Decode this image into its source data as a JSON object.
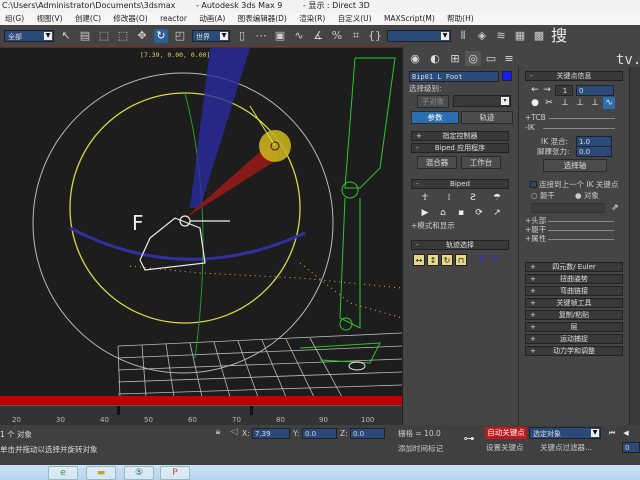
{
  "title": {
    "path": "C:\\Users\\Administrator\\Documents\\3dsmax",
    "app": "- Autodesk 3ds Max 9",
    "display": "- 显示 : Direct 3D"
  },
  "menu": [
    "组(G)",
    "视图(V)",
    "创建(C)",
    "修改器(O)",
    "reactor",
    "动画(A)",
    "图表编辑器(D)",
    "渲染(R)",
    "自定义(U)",
    "MAXScript(M)",
    "帮助(H)"
  ],
  "toolbar": {
    "selection_filter": "全部",
    "ref_coord": "世界",
    "named_sel": "",
    "watermark": "搜"
  },
  "viewport": {
    "coord_readout": "[7.39, 0.00, 0.00]",
    "axis_label": "F",
    "watermark": "tv."
  },
  "timeline": {
    "ticks": [
      "20",
      "30",
      "40",
      "50",
      "60",
      "70",
      "80",
      "90",
      "100"
    ]
  },
  "status": {
    "selected": "1 个 对象",
    "prompt": "单击并拖动以选择并旋转对象",
    "x_label": "X:",
    "x": "7.39",
    "y_label": "Y:",
    "y": "0.0",
    "z_label": "Z:",
    "z": "0.0",
    "grid": "栅格 = 10.0",
    "add_time_tag": "添加时间标记",
    "auto_key": "自动关键点",
    "set_key": "设置关键点",
    "key_mode": "选定对象",
    "key_filters": "关键点过滤器...",
    "frame": "0"
  },
  "panel": {
    "object_name": "Bip01 L Foot",
    "object_color": "#1a1aff",
    "select_level_label": "选择级别:",
    "sub_object": "子对象",
    "tab_params": "参数",
    "tab_trajectory": "轨迹",
    "assign_controller": "指定控制器",
    "biped_apps": "Biped 应用程序",
    "mixer": "混合器",
    "workbench": "工作台",
    "biped": "Biped",
    "mode_display": "+模式和显示",
    "track_select": "轨迹选择",
    "key_info": "关键点信息",
    "key_index": "1",
    "key_time": "0",
    "tcb": "+TCB",
    "ik": "-IK",
    "ik_blend_label": "IK 混合:",
    "ik_blend": "1.0",
    "ankle_label": "脚踝张力:",
    "ankle": "0.0",
    "select_pivot": "选择轴",
    "join_prev": "连接到上一个 IK 关键点",
    "body": "躯干",
    "object": "对象",
    "head": "+头部",
    "body2": "+躯干",
    "props": "+属性",
    "rollouts": [
      "四元数/ Euler",
      "扭曲姿势",
      "弯曲链接",
      "关键帧工具",
      "复制/粘贴",
      "层",
      "运动捕捉",
      "动力学和调整"
    ]
  }
}
